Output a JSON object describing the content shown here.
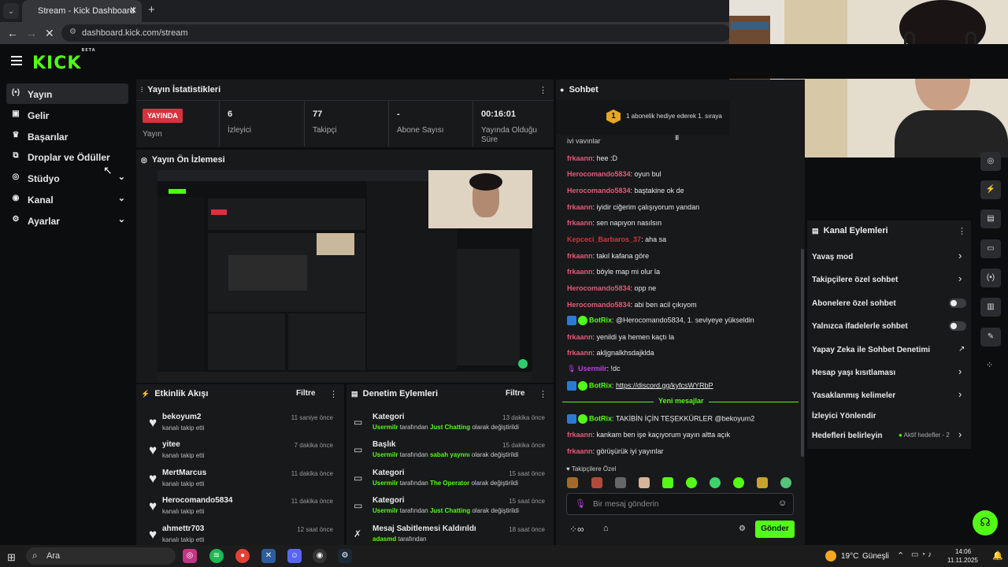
{
  "browser": {
    "tab_title": "Stream - Kick Dashboard",
    "url": "dashboard.kick.com/stream"
  },
  "brand": {
    "logo": "KICK",
    "beta": "BETA",
    "accent": "#53fc18"
  },
  "sidebar": {
    "items": [
      {
        "label": "Yayın",
        "icon": "broadcast-icon"
      },
      {
        "label": "Gelir",
        "icon": "revenue-icon"
      },
      {
        "label": "Başarılar",
        "icon": "trophy-icon"
      },
      {
        "label": "Droplar ve Ödüller",
        "icon": "drops-icon"
      },
      {
        "label": "Stüdyo",
        "icon": "studio-icon"
      },
      {
        "label": "Kanal",
        "icon": "channel-icon"
      },
      {
        "label": "Ayarlar",
        "icon": "gear-icon"
      }
    ]
  },
  "stats": {
    "title": "Yayın İstatistikleri",
    "badge": "YAYINDA",
    "badge_label": "Yayın",
    "items": [
      {
        "value": "6",
        "label": "İzleyici"
      },
      {
        "value": "77",
        "label": "Takipçi"
      },
      {
        "value": "-",
        "label": "Abone Sayısı"
      },
      {
        "value": "00:16:01",
        "label": "Yayında Olduğu Süre"
      }
    ]
  },
  "preview": {
    "title": "Yayın Ön İzlemesi"
  },
  "activity": {
    "title": "Etkinlik Akışı",
    "filter": "Filtre",
    "items": [
      {
        "name": "bekoyum2",
        "sub": "kanalı takip etti",
        "time": "11 saniye önce"
      },
      {
        "name": "yitee",
        "sub": "kanalı takip etti",
        "time": "7 dakika önce"
      },
      {
        "name": "MertMarcus",
        "sub": "kanalı takip etti",
        "time": "11 dakika önce"
      },
      {
        "name": "Herocomando5834",
        "sub": "kanalı takip etti",
        "time": "11 dakika önce"
      },
      {
        "name": "ahmettr703",
        "sub": "kanalı takip etti",
        "time": "12 saat önce"
      }
    ]
  },
  "moderation": {
    "title": "Denetim Eylemleri",
    "filter": "Filtre",
    "items": [
      {
        "title": "Kategori",
        "actor": "Usermilr",
        "mid": "tarafından",
        "target": "Just Chatting",
        "end": "olarak değiştirildi",
        "time": "13 dakika önce"
      },
      {
        "title": "Başlık",
        "actor": "Usermilr",
        "mid": "tarafından",
        "target": "sabah yaynnı",
        "end": "olarak değiştirildi",
        "time": "15 dakika önce"
      },
      {
        "title": "Kategori",
        "actor": "Usermilr",
        "mid": "tarafından",
        "target": "The Operator",
        "end": "olarak değiştirildi",
        "time": "15 saat önce"
      },
      {
        "title": "Kategori",
        "actor": "Usermilr",
        "mid": "tarafından",
        "target": "Just Chatting",
        "end": "olarak değiştirildi",
        "time": "15 saat önce"
      },
      {
        "title": "Mesaj Sabitlemesi Kaldırıldı",
        "actor": "adasmd",
        "mid": "tarafından",
        "target": "",
        "end": "",
        "time": "18 saat önce"
      }
    ]
  },
  "chat": {
    "title": "Sohbet",
    "gift_rank": "1",
    "gift_text": "1 abonelik hediye ederek 1. sıraya",
    "partial_top": "iyi yayınlar",
    "messages": [
      {
        "user": "frkaann",
        "color": "#e45a7a",
        "text": "hee :D"
      },
      {
        "user": "Herocomando5834",
        "color": "#e45a7a",
        "text": "oyun bul"
      },
      {
        "user": "Herocomando5834",
        "color": "#e45a7a",
        "text": "baştakine ok de"
      },
      {
        "user": "frkaann",
        "color": "#e45a7a",
        "text": "iyidir ciğerim çalışıyorum yandan"
      },
      {
        "user": "frkaann",
        "color": "#e45a7a",
        "text": "sen napıyon nasılsın"
      },
      {
        "user": "Kepceci_Barbaros_37",
        "color": "#c9383e",
        "text": "aha sa"
      },
      {
        "user": "frkaann",
        "color": "#e45a7a",
        "text": "takıl kafana göre"
      },
      {
        "user": "frkaann",
        "color": "#e45a7a",
        "text": "böyle map mi olur la"
      },
      {
        "user": "Herocomando5834",
        "color": "#e45a7a",
        "text": "opp ne"
      },
      {
        "user": "Herocomando5834",
        "color": "#e45a7a",
        "text": "abi ben acil çıkıyom"
      },
      {
        "user": "BotRix",
        "color": "#53fc18",
        "text": "@Herocomando5834, 1. seviyeye yükseldin",
        "bot": true
      },
      {
        "user": "frkaann",
        "color": "#e45a7a",
        "text": "yenildi ya hemen kaçtı la"
      },
      {
        "user": "frkaann",
        "color": "#e45a7a",
        "text": "akljgnalkhsdajklda"
      },
      {
        "user": "Usermilr",
        "color": "#c23ee6",
        "text": "!dc",
        "mic": true
      },
      {
        "user": "BotRix",
        "color": "#53fc18",
        "text": "https://discord.gg/kyfcsWYRbP",
        "bot": true,
        "link": true
      }
    ],
    "new_messages": "Yeni mesajlar",
    "messages_after": [
      {
        "user": "BotRix",
        "color": "#53fc18",
        "text": "TAKİBİN İÇİN TEŞEKKÜRLER @bekoyum2",
        "bot": true
      },
      {
        "user": "frkaann",
        "color": "#e45a7a",
        "text": "kankam ben işe kaçıyorum yayın altta açık"
      },
      {
        "user": "frkaann",
        "color": "#e45a7a",
        "text": "görüşürük iyi yayınlar"
      }
    ],
    "followers_only_label": "Takipçilere Özel",
    "input_placeholder": "Bir mesaj gönderin",
    "send": "Gönder"
  },
  "channel_actions": {
    "title": "Kanal Eylemleri",
    "items": [
      {
        "label": "Yavaş mod",
        "type": "chevron"
      },
      {
        "label": "Takipçilere özel sohbet",
        "type": "chevron"
      },
      {
        "label": "Abonelere özel sohbet",
        "type": "toggle"
      },
      {
        "label": "Yalnızca ifadelerle sohbet",
        "type": "toggle"
      },
      {
        "label": "Yapay Zeka ile Sohbet Denetimi",
        "type": "external"
      },
      {
        "label": "Hesap yaşı kısıtlaması",
        "type": "chevron"
      },
      {
        "label": "Yasaklanmış kelimeler",
        "type": "chevron"
      },
      {
        "label": "İzleyici Yönlendir",
        "type": "none"
      },
      {
        "label": "Hedefleri belirleyin",
        "type": "chevron"
      }
    ],
    "goals_status": "Aktif hedefler - 2"
  },
  "taskbar": {
    "search": "Ara",
    "weather": "19°C",
    "weather_text": "Güneşli",
    "time": "14:06",
    "date": "11.11.2025"
  }
}
